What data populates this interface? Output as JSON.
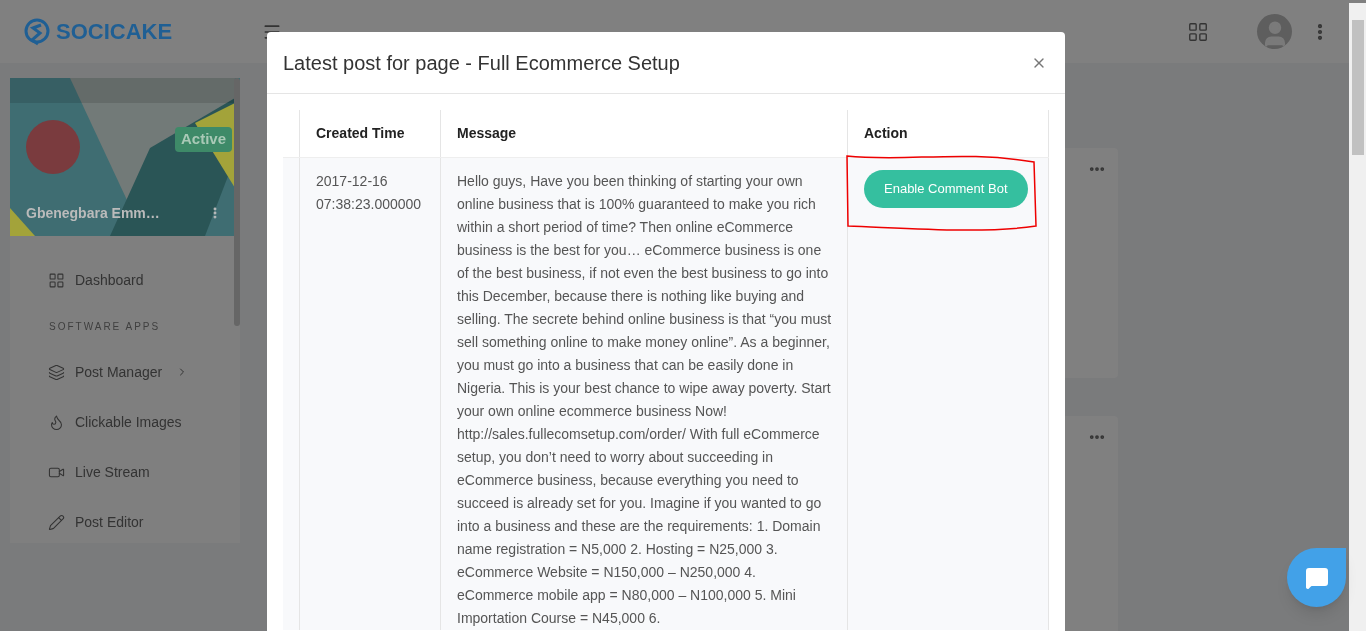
{
  "header": {
    "logo": "SOCICAKE"
  },
  "profile": {
    "name": "Gbenegbara Emm…",
    "status": "Active",
    "active": true
  },
  "sidebar": {
    "items": [
      {
        "kind": "link",
        "label": "Dashboard",
        "has_submenu": false
      },
      {
        "kind": "section",
        "label": "SOFTWARE APPS"
      },
      {
        "kind": "link",
        "label": "Post Manager",
        "has_submenu": true
      },
      {
        "kind": "link",
        "label": "Clickable Images",
        "has_submenu": false
      },
      {
        "kind": "link",
        "label": "Live Stream",
        "has_submenu": false
      },
      {
        "kind": "link",
        "label": "Post Editor",
        "has_submenu": false
      }
    ]
  },
  "modal": {
    "title": "Latest post for page - Full Ecommerce Setup",
    "table": {
      "columns": [
        "Created Time",
        "Message",
        "Action"
      ],
      "rows": [
        {
          "created_time": "2017-12-16 07:38:23.000000",
          "message": "Hello guys, Have you been thinking of starting your own online business that is 100% guaranteed to make you rich within a short period of time? Then online eCommerce business is the best for you… eCommerce business is one of the best business, if not even the best business to go into this December, because there is nothing like buying and selling. The secrete behind online business is that “you must sell something online to make money online”. As a beginner, you must go into a business that can be easily done in Nigeria. This is your best chance to wipe away poverty. Start your own online ecommerce business Now! http://sales.fullecomsetup.com/order/ With full eCommerce setup, you don’t need to worry about succeeding in eCommerce business, because everything you need to succeed is already set for you. Imagine if you wanted to go into a business and these are the requirements: 1. Domain name registration = N5,000 2. Hosting = N25,000 3. eCommerce Website = N150,000 – N250,000 4. eCommerce mobile app = N80,000 – N100,000 5. Mini Importation Course = N45,000 6.",
          "action": "Enable Comment Bot",
          "highlighted": true
        }
      ]
    }
  }
}
